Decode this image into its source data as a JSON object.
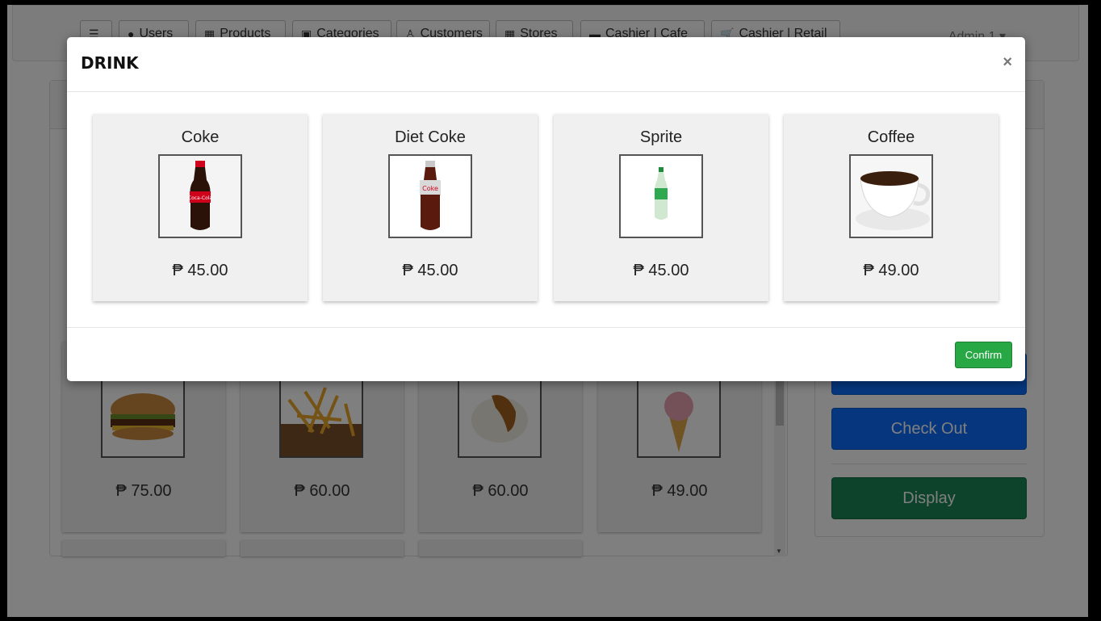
{
  "nav": {
    "buttons": [
      {
        "label": "",
        "icon": "list-icon"
      },
      {
        "label": "Users",
        "icon": "user-icon"
      },
      {
        "label": "Products",
        "icon": "box-icon"
      },
      {
        "label": "Categories",
        "icon": "clipboard-icon"
      },
      {
        "label": "Customers",
        "icon": "person-icon"
      },
      {
        "label": "Stores",
        "icon": "grid-icon"
      },
      {
        "label": "Cashier | Cafe",
        "icon": "cup-icon"
      },
      {
        "label": "Cashier | Retail",
        "icon": "cart-icon"
      }
    ],
    "admin_label": "Admin 1 ▾"
  },
  "background": {
    "product_prices": [
      "₱ 75.00",
      "₱ 60.00",
      "₱ 60.00",
      "₱ 49.00"
    ],
    "product_images": [
      "burger-image",
      "fries-image",
      "rice-gravy-image",
      "ice-cream-image"
    ],
    "checkout_label": "Check Out",
    "display_label": "Display"
  },
  "modal": {
    "title": "DRINK",
    "close_symbol": "×",
    "confirm_label": "Confirm",
    "items": [
      {
        "name": "Coke",
        "price": "₱ 45.00",
        "image": "coke-bottle-image"
      },
      {
        "name": "Diet Coke",
        "price": "₱ 45.00",
        "image": "diet-coke-bottle-image"
      },
      {
        "name": "Sprite",
        "price": "₱ 45.00",
        "image": "sprite-bottle-image"
      },
      {
        "name": "Coffee",
        "price": "₱ 49.00",
        "image": "coffee-cup-image"
      }
    ]
  },
  "colors": {
    "confirm_green": "#28a745",
    "primary_blue": "#0d6efd",
    "display_green": "#198754"
  }
}
